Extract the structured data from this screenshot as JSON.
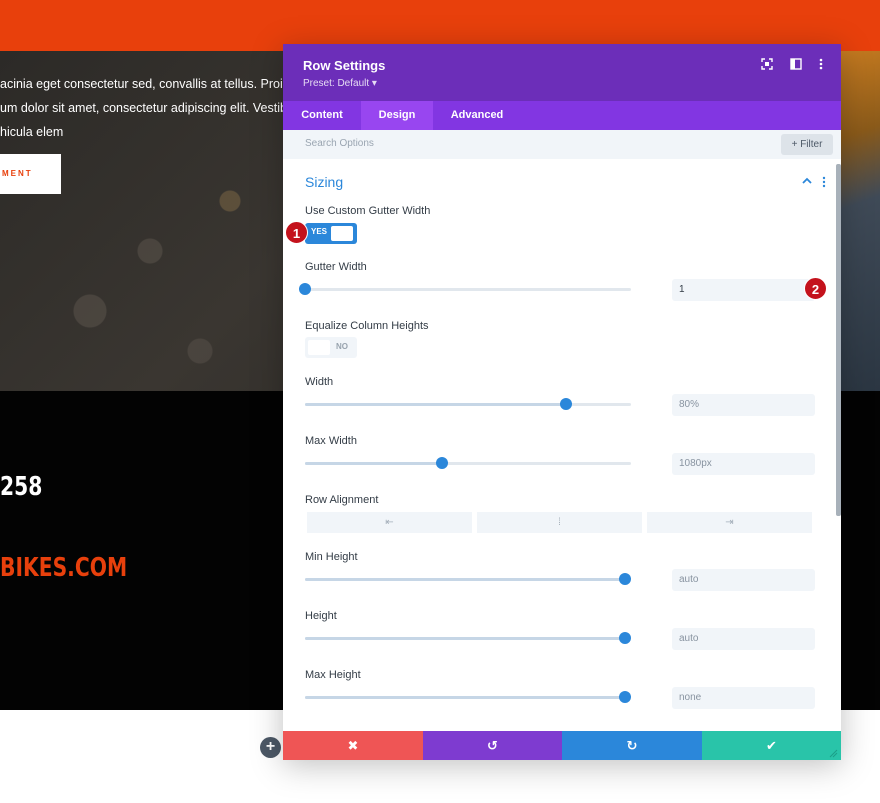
{
  "background": {
    "hero_lines": [
      "acinia eget consectetur sed, convallis at tellus. Proin",
      "um dolor sit amet, consectetur adipiscing elit. Vestibu",
      "hicula elem"
    ],
    "hero_button": "MENT",
    "phone": "258",
    "email": "BIKES.COM",
    "add_button": "+"
  },
  "modal": {
    "title": "Row Settings",
    "preset": "Preset: Default ▾",
    "header_icons": [
      "expand-icon",
      "sidebar-layout-icon",
      "more-icon"
    ],
    "tabs": [
      "Content",
      "Design",
      "Advanced"
    ],
    "active_tab": "Design",
    "search_placeholder": "Search Options",
    "filter_label": "+ Filter",
    "section_title": "Sizing",
    "custom_gutter": {
      "label": "Use Custom Gutter Width",
      "state": "YES"
    },
    "gutter_width": {
      "label": "Gutter Width",
      "value": "1",
      "slider": 0.0
    },
    "equalize": {
      "label": "Equalize Column Heights",
      "state": "NO"
    },
    "width": {
      "label": "Width",
      "value": "80%",
      "slider": 0.8
    },
    "max_width": {
      "label": "Max Width",
      "value": "1080px",
      "slider": 0.42
    },
    "row_alignment": {
      "label": "Row Alignment",
      "options": [
        "⇤",
        "⁞",
        "⇥"
      ]
    },
    "min_height": {
      "label": "Min Height",
      "value": "auto",
      "slider": 1.0
    },
    "height": {
      "label": "Height",
      "value": "auto",
      "slider": 1.0
    },
    "max_height": {
      "label": "Max Height",
      "value": "none",
      "slider": 1.0
    },
    "footer": {
      "cancel": "✖",
      "undo": "↺",
      "redo": "↻",
      "save": "✔",
      "colors": {
        "cancel": "#ef5555",
        "undo": "#7e3bd0",
        "redo": "#2b87da",
        "save": "#29c4a9"
      }
    }
  },
  "markers": [
    "1",
    "2"
  ],
  "colors": {
    "brand_orange": "#e8400c",
    "modal_header": "#6c2eb9",
    "tabs": "#8236e2",
    "accent_blue": "#2b87da",
    "marker_red": "#c4121c"
  }
}
